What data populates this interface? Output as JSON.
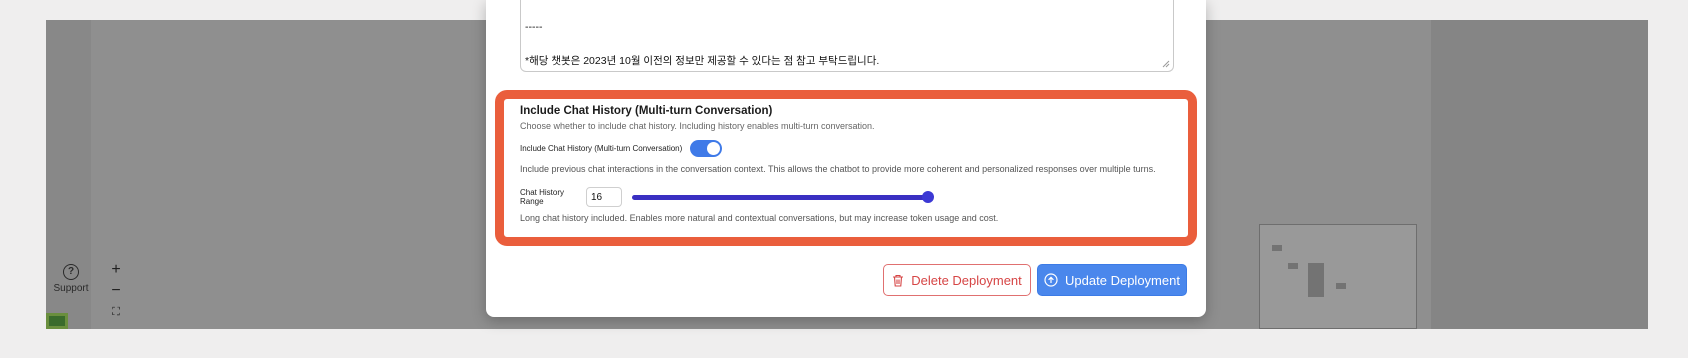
{
  "sidebar": {
    "support_label": "Support",
    "support_glyph": "?"
  },
  "zoom_controls": {
    "zoom_in": "+",
    "zoom_out": "−",
    "fit": "⛶"
  },
  "system_prompt": {
    "separator": "-----",
    "notice": "*해당 챗봇은 2023년 10월 이전의 정보만 제공할 수 있다는 점 참고 부탁드립니다."
  },
  "chat_history": {
    "title": "Include Chat History (Multi-turn Conversation)",
    "description": "Choose whether to include chat history. Including history enables multi-turn conversation.",
    "toggle_label": "Include Chat History (Multi-turn Conversation)",
    "toggle_enabled": true,
    "toggle_description": "Include previous chat interactions in the conversation context. This allows the chatbot to provide more coherent and personalized responses over multiple turns.",
    "range_label": "Chat History Range",
    "range_value": "16",
    "range_description": "Long chat history included. Enables more natural and contextual conversations, but may increase token usage and cost."
  },
  "actions": {
    "delete_label": "Delete Deployment",
    "update_label": "Update Deployment"
  },
  "colors": {
    "highlight": "#ea5e3c",
    "primary": "#4a87ec",
    "danger": "#d64545",
    "slider": "#3a2fc2"
  },
  "icons": {
    "delete": "trash-icon",
    "update": "upload-circle-icon",
    "support": "help-circle-icon"
  }
}
